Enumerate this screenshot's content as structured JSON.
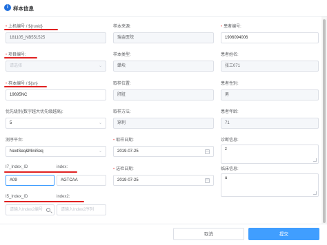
{
  "header": {
    "icon": "info-icon",
    "title": "样本信息"
  },
  "fields": {
    "machine_no": {
      "label": "上机编号 / ${runid}",
      "value": "181105_NB551525"
    },
    "sample_source": {
      "label": "样本来源:",
      "value": "瑞金医院"
    },
    "patient_no": {
      "label": "患者编号:",
      "value": "1906094006"
    },
    "project_no": {
      "label": "项目编号:",
      "placeholder": "请选择"
    },
    "sample_type": {
      "label": "样本类型:",
      "value": "蜡块"
    },
    "patient_name": {
      "label": "患者姓名:",
      "value": "张三071"
    },
    "sample_no": {
      "label": "样本编号 / ${sn}",
      "value": "19695NC"
    },
    "sampling_site": {
      "label": "取样位置:",
      "value": "肝脏"
    },
    "patient_gender": {
      "label": "患者性别:",
      "value": "男"
    },
    "priority": {
      "label": "优先级别(数字越大优先级越高):",
      "value": "5"
    },
    "sampling_method": {
      "label": "取样方法:",
      "value": "穿刺"
    },
    "patient_age": {
      "label": "患者年龄:",
      "value": "71"
    },
    "platform": {
      "label": "测序平台:",
      "value": "NextSeq&MiniSeq"
    },
    "sampling_date": {
      "label": "取样日期:",
      "value": "2019-07-25"
    },
    "diagnosis": {
      "label": "诊断信息:",
      "value": "z"
    },
    "i7_index_id": {
      "label": "I7_Index_ID",
      "value": "A09"
    },
    "index": {
      "label": "index:",
      "value": "AGTCAA"
    },
    "delivery_date": {
      "label": "送检日期:",
      "value": "2019-07-25"
    },
    "clinical_info": {
      "label": "临床信息:",
      "value": "u"
    },
    "i5_index_id": {
      "label": "I5_Index_ID",
      "placeholder": "请输入Index2编号"
    },
    "index2": {
      "label": "index2:",
      "placeholder": "请输入Index2序列"
    }
  },
  "footer": {
    "cancel_label": "取消",
    "submit_label": "提交"
  },
  "colors": {
    "primary": "#409eff",
    "required": "#f56c6c",
    "annotation_underline": "#e02020",
    "header_icon": "#1f6fde"
  }
}
